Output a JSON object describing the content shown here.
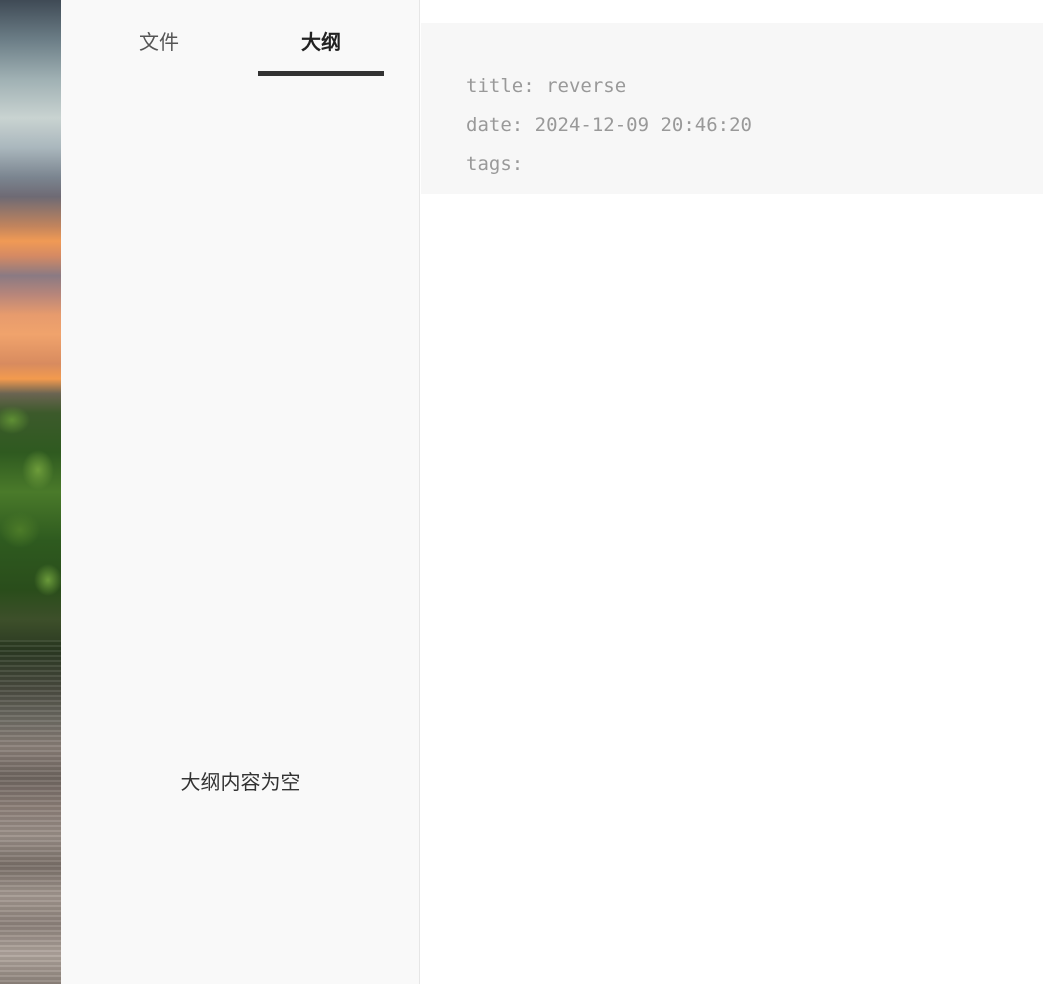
{
  "sidebar": {
    "tabs": [
      {
        "label": "文件",
        "active": false
      },
      {
        "label": "大纲",
        "active": true
      }
    ],
    "empty_message": "大纲内容为空"
  },
  "editor": {
    "front_matter": [
      "title: reverse",
      "date: 2024-12-09 20:46:20",
      "tags:"
    ]
  },
  "colors": {
    "sidebar_bg": "#f9f9f9",
    "front_matter_bg": "#f7f7f7",
    "front_matter_text": "#999999",
    "active_tab_indicator": "#333333"
  }
}
